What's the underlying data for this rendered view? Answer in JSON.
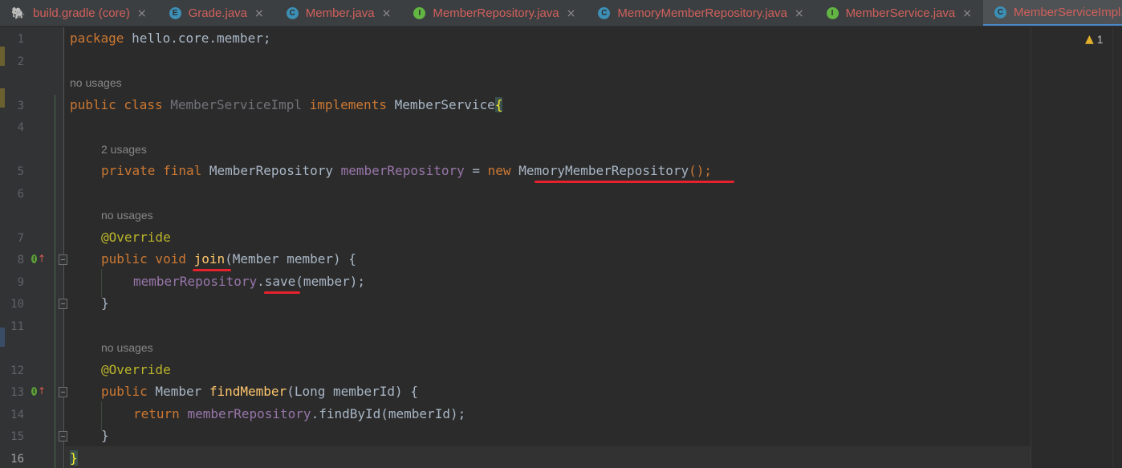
{
  "tabs": [
    {
      "label": "build.gradle (core)",
      "icon": "gradle-icon",
      "icon_char": "🐘",
      "active": false
    },
    {
      "label": "Grade.java",
      "icon": "enum-icon",
      "icon_char": "E",
      "active": false
    },
    {
      "label": "Member.java",
      "icon": "class-icon",
      "icon_char": "C",
      "active": false
    },
    {
      "label": "MemberRepository.java",
      "icon": "interface-icon",
      "icon_char": "I",
      "active": false
    },
    {
      "label": "MemoryMemberRepository.java",
      "icon": "class-icon",
      "icon_char": "C",
      "active": false
    },
    {
      "label": "MemberService.java",
      "icon": "interface-icon",
      "icon_char": "I",
      "active": false
    },
    {
      "label": "MemberServiceImpl.java",
      "icon": "class-icon",
      "icon_char": "C",
      "active": true
    }
  ],
  "tab_close_glyph": "×",
  "inspection": {
    "icon": "warning-icon",
    "glyph": "▲",
    "count": "1"
  },
  "line_numbers": [
    "1",
    "2",
    "3",
    "4",
    "5",
    "6",
    "7",
    "8",
    "9",
    "10",
    "11",
    "12",
    "13",
    "14",
    "15",
    "16"
  ],
  "hints": {
    "class_usages": "no usages",
    "field_usages": "2 usages",
    "join_usages": "no usages",
    "find_usages": "no usages"
  },
  "code": {
    "l1": {
      "kw": "package",
      "rest": " hello.core.member;"
    },
    "l3": {
      "kw1": "public class",
      "name": " MemberServiceImpl ",
      "kw2": "implements",
      "iface": " MemberService",
      "brace": "{"
    },
    "l5": {
      "kw": "private final",
      "type": " MemberRepository ",
      "field": "memberRepository",
      "eq": " = ",
      "new": "new",
      "ctor": " MemoryMemberRepository",
      "end": "();"
    },
    "l7": {
      "annot": "@Override"
    },
    "l8": {
      "kw": "public void ",
      "meth": "join",
      "params": "(Member member) {"
    },
    "l9": {
      "field": "memberRepository",
      "call": ".save",
      "args": "(member);"
    },
    "l10": {
      "text": "}"
    },
    "l12": {
      "annot": "@Override"
    },
    "l13": {
      "kw": "public",
      "type": " Member ",
      "meth": "findMember",
      "params": "(Long memberId) {"
    },
    "l14": {
      "kw": "return ",
      "field": "memberRepository",
      "call": ".findById(memberId);"
    },
    "l15": {
      "text": "}"
    },
    "l16": {
      "text": "}"
    }
  },
  "colors": {
    "keyword": "#cc7832",
    "field": "#9876aa",
    "annotation": "#bbb529",
    "method": "#ffc66d",
    "underline": "#e8222d"
  }
}
